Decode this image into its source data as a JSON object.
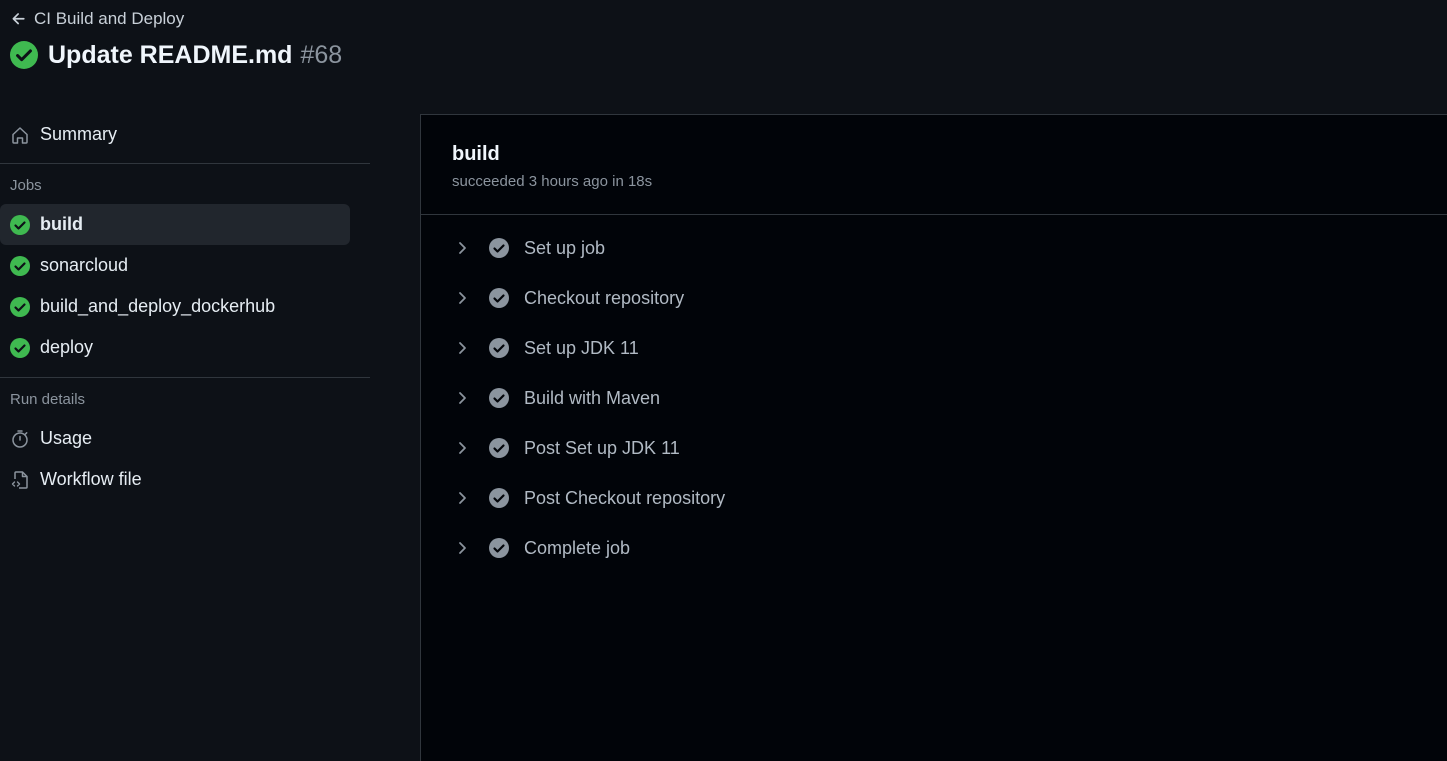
{
  "header": {
    "back_label": "CI Build and Deploy",
    "title": "Update README.md",
    "run_number": "#68"
  },
  "sidebar": {
    "summary_label": "Summary",
    "jobs_heading": "Jobs",
    "jobs": [
      {
        "label": "build",
        "status": "success",
        "active": true
      },
      {
        "label": "sonarcloud",
        "status": "success",
        "active": false
      },
      {
        "label": "build_and_deploy_dockerhub",
        "status": "success",
        "active": false
      },
      {
        "label": "deploy",
        "status": "success",
        "active": false
      }
    ],
    "run_details_heading": "Run details",
    "usage_label": "Usage",
    "workflow_file_label": "Workflow file"
  },
  "job": {
    "name": "build",
    "status_text": "succeeded 3 hours ago in 18s",
    "steps": [
      {
        "label": "Set up job"
      },
      {
        "label": "Checkout repository"
      },
      {
        "label": "Set up JDK 11"
      },
      {
        "label": "Build with Maven"
      },
      {
        "label": "Post Set up JDK 11"
      },
      {
        "label": "Post Checkout repository"
      },
      {
        "label": "Complete job"
      }
    ]
  },
  "colors": {
    "success_green": "#3fb950",
    "step_check_grey": "#8b949e",
    "background": "#0d1117",
    "panel_background": "#010409"
  }
}
